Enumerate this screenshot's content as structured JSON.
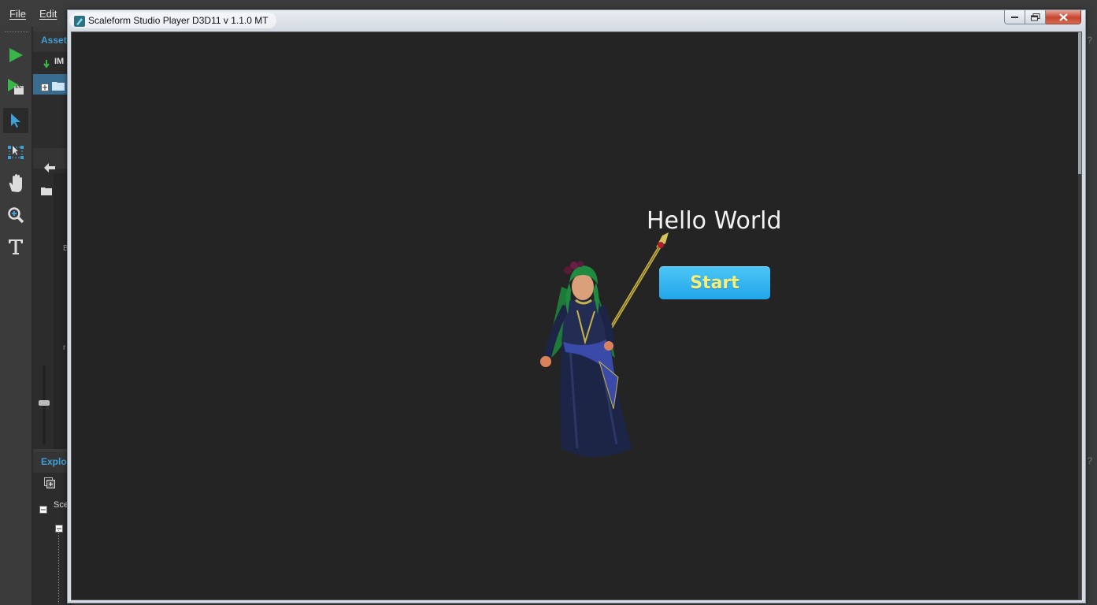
{
  "menubar": {
    "items": [
      "File",
      "Edit"
    ]
  },
  "toolbar": {
    "tools": [
      "play-icon",
      "play-scene-icon",
      "select-arrow-icon",
      "transform-icon",
      "hand-pan-icon",
      "zoom-icon",
      "text-tool-icon"
    ]
  },
  "assets_panel": {
    "title": "Assets",
    "import_label": "IM",
    "item_label": "B",
    "item_label_2": "r"
  },
  "explorer_panel": {
    "title": "Explo",
    "tree_root": "Sce"
  },
  "help_marker": "?",
  "player": {
    "title": "Scaleform Studio Player D3D11 v 1.1.0  MT",
    "hello_text": "Hello World",
    "start_label": "Start"
  },
  "colors": {
    "accent_blue": "#3fa0d8",
    "start_button": "#2fb4f0",
    "start_text": "#f4ef7a",
    "viewport_bg": "#242424",
    "play_green": "#3ab54a"
  }
}
